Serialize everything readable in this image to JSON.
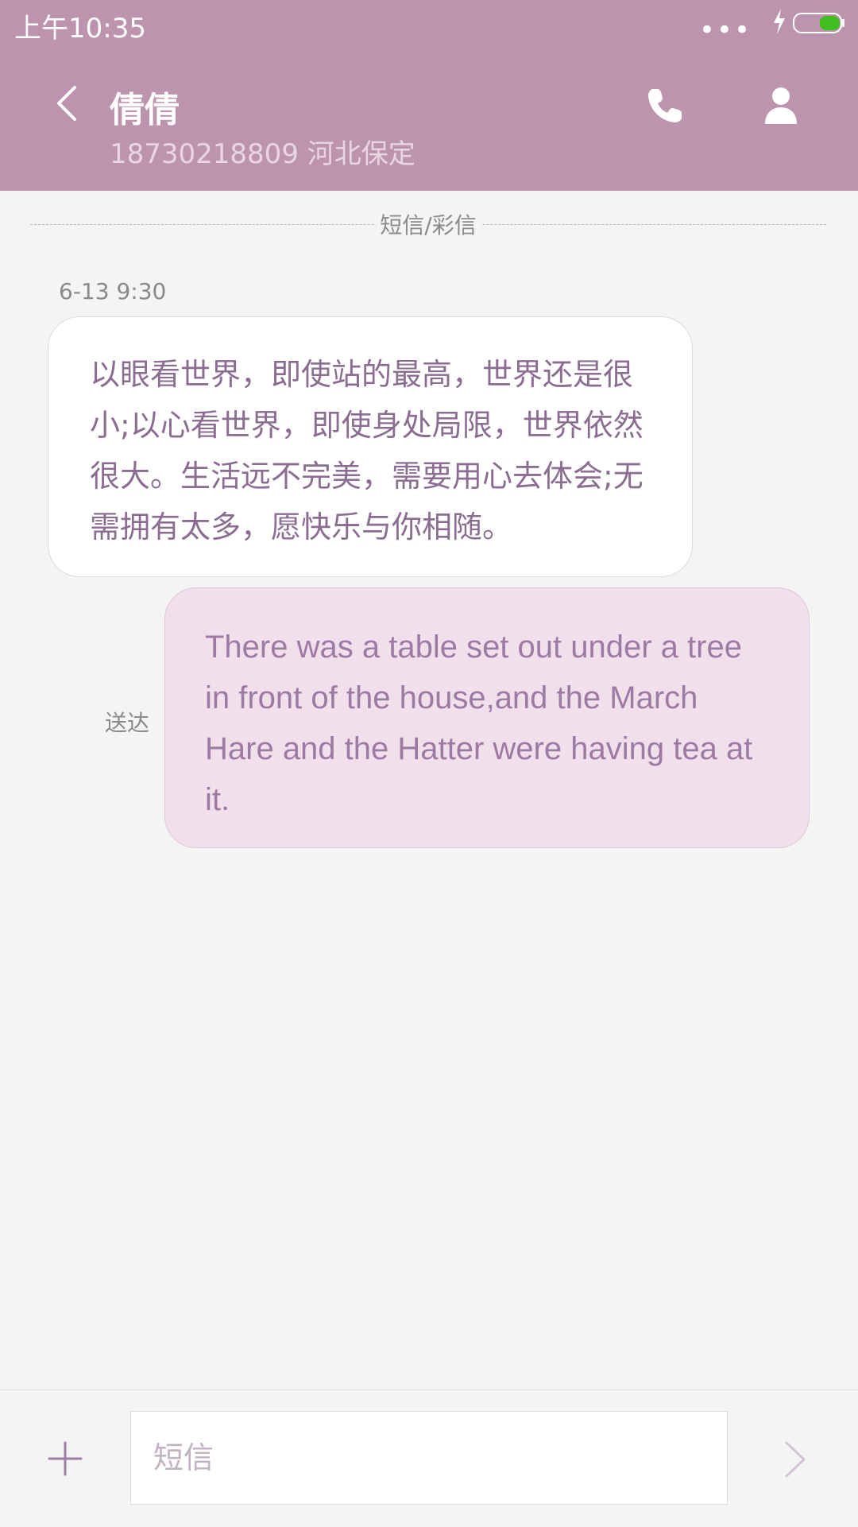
{
  "status_bar": {
    "time": "上午10:35",
    "dots": "•••"
  },
  "header": {
    "contact_name": "倩倩",
    "contact_detail": "18730218809 河北保定"
  },
  "icons": {
    "back": "back-icon",
    "phone": "phone-icon",
    "person": "person-icon",
    "add": "plus-icon",
    "send": "chevron-right-icon",
    "charging": "bolt-icon",
    "battery": "battery-icon"
  },
  "conversation": {
    "channel_label": "短信/彩信",
    "messages": [
      {
        "direction": "incoming",
        "timestamp": "6-13 9:30",
        "text": "以眼看世界，即使站的最高，世界还是很小;以心看世界，即使身处局限，世界依然很大。生活远不完美，需要用心去体会;无需拥有太多，愿快乐与你相随。"
      },
      {
        "direction": "outgoing",
        "status": "送达",
        "text": "There was a table set out under a tree in front of the house,and the March Hare and the Hatter were having tea at it."
      }
    ]
  },
  "composer": {
    "placeholder": "短信"
  },
  "colors": {
    "header_bg": "#bc94ad",
    "incoming_bubble": "#ffffff",
    "outgoing_bubble": "#f1e0ec",
    "message_text": "#8a6d90",
    "battery_fill": "#3fbf1f"
  },
  "battery": {
    "level": 0.45
  }
}
